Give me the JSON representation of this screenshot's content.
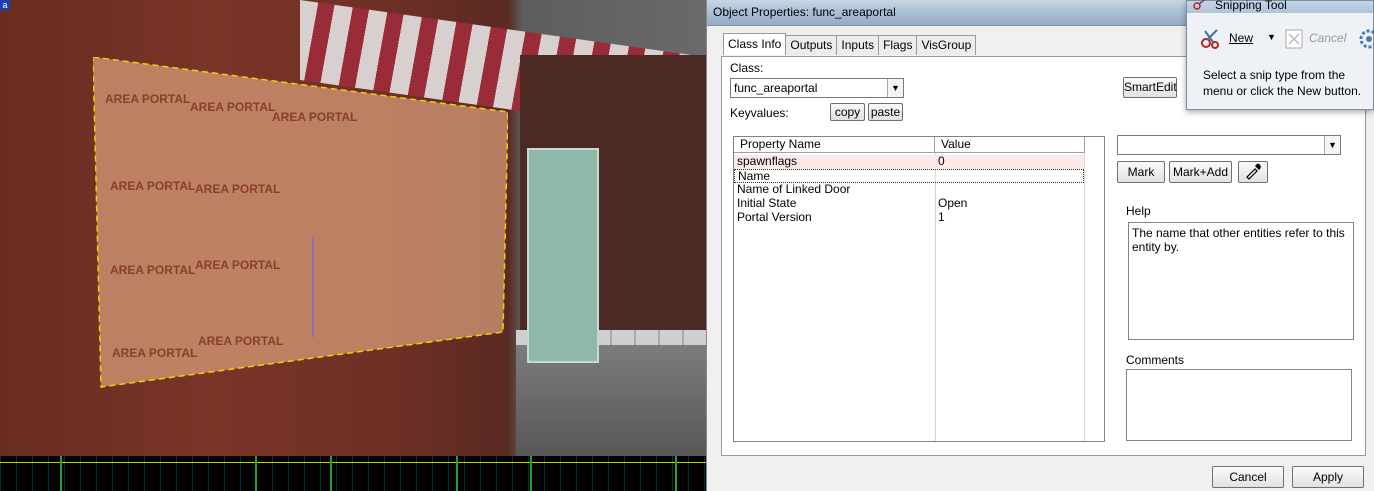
{
  "viewport": {
    "corner_label": "a",
    "portal_label": "AREA PORTAL"
  },
  "dialog": {
    "title": "Object Properties: func_areaportal",
    "tabs": [
      {
        "label": "Class Info",
        "active": true
      },
      {
        "label": "Outputs"
      },
      {
        "label": "Inputs"
      },
      {
        "label": "Flags"
      },
      {
        "label": "VisGroup"
      }
    ],
    "class_label": "Class:",
    "class_value": "func_areaportal",
    "keyvalues_label": "Keyvalues:",
    "copy_label": "copy",
    "paste_label": "paste",
    "smartedit_label": "SmartEdit",
    "grid": {
      "headers": [
        "Property Name",
        "Value"
      ],
      "rows": [
        {
          "name": "spawnflags",
          "value": "0"
        },
        {
          "name": "Name",
          "value": ""
        },
        {
          "name": "Name of Linked Door",
          "value": ""
        },
        {
          "name": "Initial State",
          "value": "Open"
        },
        {
          "name": "Portal Version",
          "value": "1"
        }
      ]
    },
    "value_combo": "",
    "mark_label": "Mark",
    "mark_add_label": "Mark+Add",
    "help_label": "Help",
    "help_text": "The name that other entities refer to this entity by.",
    "comments_label": "Comments",
    "comments_text": "",
    "cancel_label": "Cancel",
    "apply_label": "Apply"
  },
  "snipping_tool": {
    "title": "Snipping Tool",
    "new_label": "New",
    "cancel_label": "Cancel",
    "message": "Select a snip type from the menu or click the New button."
  },
  "colors": {
    "portal_fill": "#d9a07a",
    "portal_outline": "#f2d000",
    "selected_row": "#fde9e9"
  }
}
